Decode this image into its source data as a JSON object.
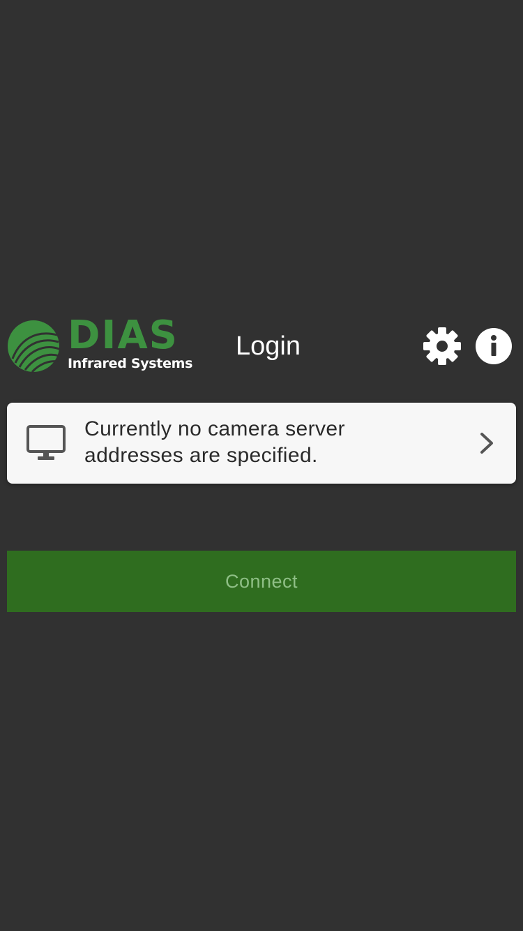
{
  "header": {
    "logo": {
      "wordmark": "DIAS",
      "tagline": "Infrared Systems"
    },
    "title": "Login",
    "settings_icon": "gear-icon",
    "info_icon": "info-icon"
  },
  "server_card": {
    "icon": "monitor-icon",
    "message": "Currently no camera server addresses are specified.",
    "action_icon": "chevron-right-icon"
  },
  "connect_button": {
    "label": "Connect"
  },
  "colors": {
    "background": "#313131",
    "brand_green": "#3d9140",
    "button_green": "#2f6d1f",
    "card_background": "#f7f7f7"
  }
}
